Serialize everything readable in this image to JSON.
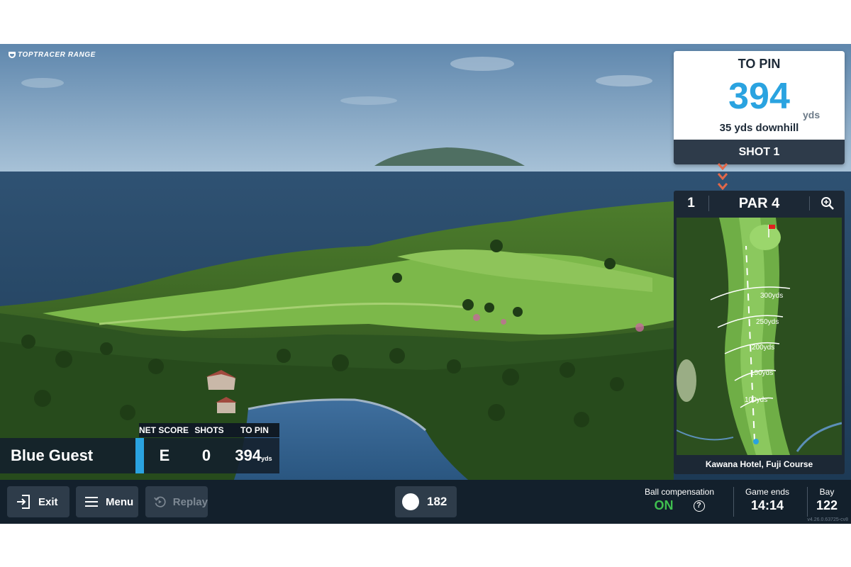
{
  "brand": {
    "logo_text": "TOPTRACER RANGE"
  },
  "to_pin_card": {
    "title": "TO PIN",
    "distance": "394",
    "unit": "yds",
    "elevation": "35 yds downhill",
    "shot_label": "SHOT 1"
  },
  "hole": {
    "number": "1",
    "par": "PAR 4",
    "course_name": "Kawana Hotel, Fuji Course",
    "distance_markers": [
      "300yds",
      "250yds",
      "200yds",
      "150yds",
      "100yds"
    ]
  },
  "scoreboard": {
    "headers": [
      "NET SCORE",
      "SHOTS",
      "TO PIN"
    ],
    "player_name": "Blue Guest",
    "net_score": "E",
    "shots": "0",
    "to_pin": "394",
    "to_pin_unit": "yds"
  },
  "bottom_bar": {
    "exit_label": "Exit",
    "menu_label": "Menu",
    "replay_label": "Replay",
    "balls_count": "182",
    "ball_compensation_label": "Ball compensation",
    "ball_compensation_value": "ON",
    "help_symbol": "?",
    "game_ends_label": "Game ends",
    "game_ends_value": "14:14",
    "bay_label": "Bay",
    "bay_value": "122",
    "version": "v4.26.0.63725-cv8"
  },
  "colors": {
    "accent_blue": "#2aa3e0",
    "on_green": "#3fbf4f",
    "panel_dark": "#1c2835",
    "chevron": "#e0684a"
  },
  "icons": [
    "exit-icon",
    "menu-icon",
    "replay-icon",
    "zoom-in-icon",
    "ball-icon",
    "help-icon",
    "flag-icon"
  ]
}
